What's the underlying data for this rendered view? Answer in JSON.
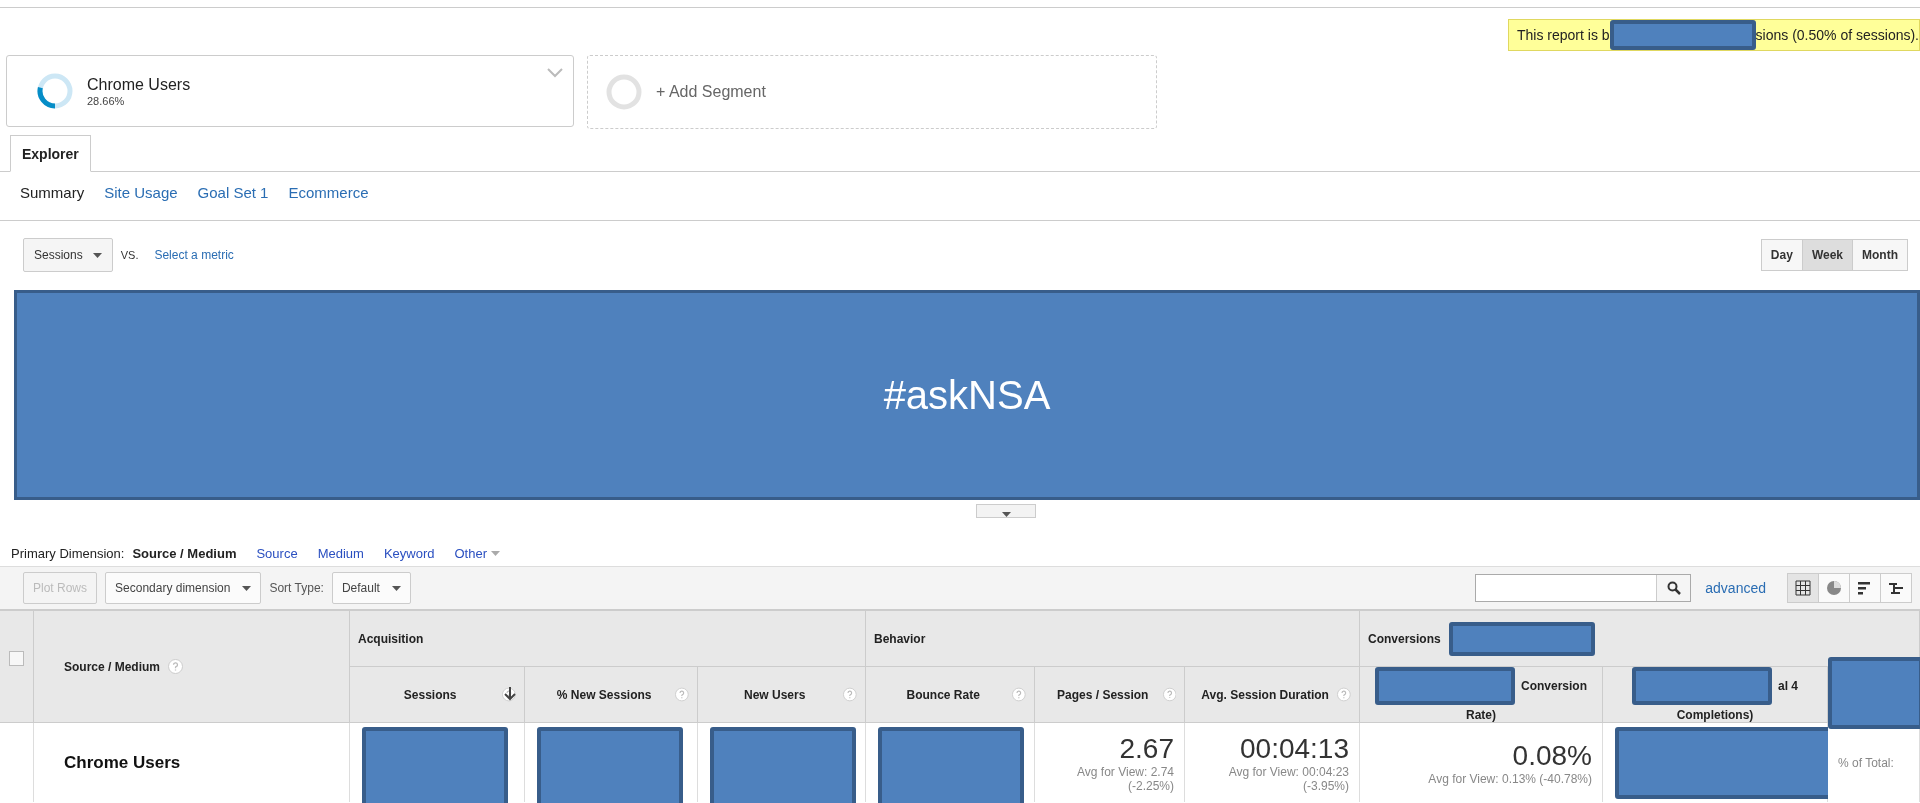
{
  "notice": {
    "text_before": "This report is b",
    "redacted": true,
    "text_after": "sions (0.50% of sessions)."
  },
  "segments": [
    {
      "name": "Chrome Users",
      "percent": "28.66%",
      "level": 0.2866
    }
  ],
  "add_segment": "+ Add Segment",
  "tabs": [
    {
      "label": "Explorer",
      "selected": true
    }
  ],
  "subtabs": [
    {
      "label": "Summary",
      "selected": true
    },
    {
      "label": "Site Usage",
      "selected": false
    },
    {
      "label": "Goal Set 1",
      "selected": false
    },
    {
      "label": "Ecommerce",
      "selected": false
    }
  ],
  "metric_dropdown": "Sessions",
  "vs": "VS.",
  "select_metric": "Select a metric",
  "periods": [
    {
      "label": "Day",
      "selected": false
    },
    {
      "label": "Week",
      "selected": true
    },
    {
      "label": "Month",
      "selected": false
    }
  ],
  "banner": "#askNSA",
  "primary_dimension": {
    "label": "Primary Dimension:",
    "options": [
      {
        "label": "Source / Medium",
        "selected": true
      },
      {
        "label": "Source",
        "selected": false
      },
      {
        "label": "Medium",
        "selected": false
      },
      {
        "label": "Keyword",
        "selected": false
      },
      {
        "label": "Other",
        "selected": false
      }
    ]
  },
  "toolbar": {
    "plot_rows": {
      "label": "Plot Rows",
      "disabled": true
    },
    "secondary": "Secondary dimension",
    "sort_label": "Sort Type:",
    "sort": "Default",
    "advanced": "advanced",
    "views": [
      {
        "kind": "grid",
        "selected": true
      },
      {
        "kind": "pie",
        "selected": false
      },
      {
        "kind": "bars",
        "selected": false
      },
      {
        "kind": "pivot",
        "selected": false
      }
    ]
  },
  "table": {
    "select_all": {
      "checked": false
    },
    "dimension_header": "Source / Medium",
    "groups": [
      {
        "label": "Acquisition",
        "redacted": false
      },
      {
        "label": "Behavior",
        "redacted": false
      },
      {
        "label": "Conversions",
        "redacted": true
      }
    ],
    "columns": [
      {
        "label": "Sessions",
        "sorted": true,
        "redacted": false
      },
      {
        "label": "% New Sessions",
        "sorted": false,
        "redacted": false
      },
      {
        "label": "New Users",
        "sorted": false,
        "redacted": false
      },
      {
        "label": "Bounce Rate",
        "sorted": false,
        "redacted": false
      },
      {
        "label": "Pages / Session",
        "sorted": false,
        "redacted": false
      },
      {
        "label": "Avg. Session Duration",
        "sorted": false,
        "redacted": false
      },
      {
        "label": "Conversion",
        "label_2": "Rate)",
        "sorted": false,
        "redacted": true
      },
      {
        "label": "al 4",
        "label_2": "Completions)",
        "sorted": false,
        "redacted": true
      },
      {
        "sorted": false,
        "redacted": true
      }
    ],
    "rows": [
      {
        "name": "Chrome Users",
        "cells": [
          {
            "redacted": true
          },
          {
            "redacted": true
          },
          {
            "redacted": true
          },
          {
            "redacted": true
          },
          {
            "value": "2.67",
            "note": "Avg for View: 2.74",
            "note_2": "(-2.25%)",
            "redacted": false
          },
          {
            "value": "00:04:13",
            "note": "Avg for View: 00:04:23",
            "note_2": "(-3.95%)",
            "redacted": false
          },
          {
            "value": "0.08%",
            "note": "Avg for View: 0.13% (-40.78%)",
            "redacted": false
          },
          {
            "redacted": true
          },
          {
            "note": "% of Total:",
            "redacted": false
          }
        ]
      }
    ]
  }
}
